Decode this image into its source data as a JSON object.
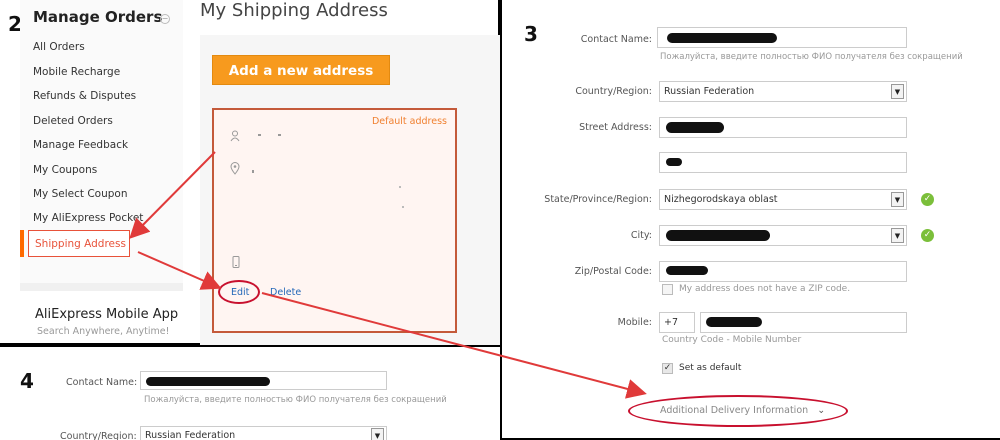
{
  "steps": {
    "panel2": "2",
    "panel3": "3",
    "panel4": "4"
  },
  "sidebar": {
    "title": "Manage Orders",
    "collapse_icon": "minus-circle-icon",
    "items": [
      {
        "label": "All Orders"
      },
      {
        "label": "Mobile Recharge"
      },
      {
        "label": "Refunds & Disputes"
      },
      {
        "label": "Deleted Orders"
      },
      {
        "label": "Manage Feedback"
      },
      {
        "label": "My Coupons"
      },
      {
        "label": "My Select Coupon"
      },
      {
        "label": "My AliExpress Pocket"
      }
    ],
    "active_item": "Shipping Address",
    "app_title": "AliExpress Mobile App",
    "app_subtitle": "Search Anywhere, Anytime!"
  },
  "shipping": {
    "page_title": "My Shipping Address",
    "add_button": "Add a new address",
    "default_label": "Default address",
    "edit_label": "Edit",
    "delete_label": "Delete",
    "icons": [
      "user-icon",
      "location-pin-icon",
      "phone-icon"
    ]
  },
  "form": {
    "contact_label": "Contact Name:",
    "contact_hint": "Пожалуйста, введите полностью ФИО получателя без сокращений",
    "country_label": "Country/Region:",
    "country_value": "Russian Federation",
    "street_label": "Street Address:",
    "state_label": "State/Province/Region:",
    "state_value": "Nizhegorodskaya oblast",
    "city_label": "City:",
    "zip_label": "Zip/Postal Code:",
    "no_zip_label": "My address does not have a ZIP code.",
    "mobile_label": "Mobile:",
    "mobile_code": "+7",
    "mobile_hint": "Country Code - Mobile Number",
    "default_label": "Set as default",
    "default_checked": "✓",
    "delivery_link": "Additional Delivery Information"
  },
  "form4": {
    "contact_label": "Contact Name:",
    "contact_hint": "Пожалуйста, введите полностью ФИО получателя без сокращений",
    "country_label": "Country/Region:",
    "country_value": "Russian Federation"
  },
  "colors": {
    "accent": "#f79a1e",
    "highlight": "#c8102e",
    "link": "#2468b8",
    "ok": "#7bbf3a"
  }
}
